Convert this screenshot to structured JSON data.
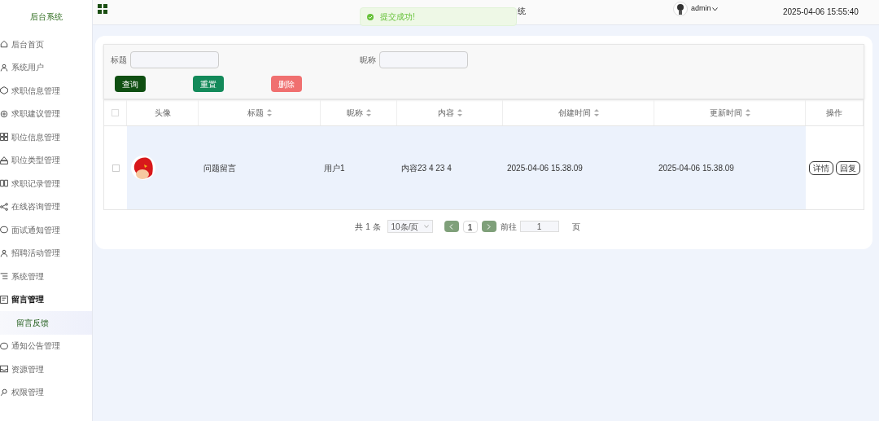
{
  "sidebar": {
    "title": "后台系统",
    "items": [
      {
        "label": "后台首页",
        "selected": false,
        "expanded": false
      },
      {
        "label": "系统用户",
        "selected": false,
        "expanded": false
      },
      {
        "label": "求职信息管理",
        "selected": false,
        "expanded": false
      },
      {
        "label": "求职建议管理",
        "selected": false,
        "expanded": false
      },
      {
        "label": "职位信息管理",
        "selected": false,
        "expanded": false
      },
      {
        "label": "职位类型管理",
        "selected": false,
        "expanded": false
      },
      {
        "label": "求职记录管理",
        "selected": false,
        "expanded": false
      },
      {
        "label": "在线咨询管理",
        "selected": false,
        "expanded": false
      },
      {
        "label": "面试通知管理",
        "selected": false,
        "expanded": false
      },
      {
        "label": "招聘活动管理",
        "selected": false,
        "expanded": false
      },
      {
        "label": "系统管理",
        "selected": false,
        "expanded": false
      },
      {
        "label": "留言管理",
        "selected": false,
        "expanded": true,
        "children": [
          {
            "label": "留言反馈",
            "selected": true
          }
        ]
      },
      {
        "label": "通知公告管理",
        "selected": false,
        "expanded": false
      },
      {
        "label": "资源管理",
        "selected": false,
        "expanded": false
      },
      {
        "label": "权限管理",
        "selected": false,
        "expanded": false
      }
    ]
  },
  "header": {
    "title_fragment": "统",
    "user": "admin",
    "datetime": "2025-04-06 15:55:40"
  },
  "toast": {
    "message": "提交成功!"
  },
  "search": {
    "fields": [
      {
        "label": "标题"
      },
      {
        "label": "昵称"
      }
    ],
    "buttons": [
      {
        "label": "查询",
        "kind": "query"
      },
      {
        "label": "重置",
        "kind": "reset"
      },
      {
        "label": "删除",
        "kind": "delete"
      }
    ]
  },
  "table": {
    "select_all_checked": false,
    "columns": [
      {
        "label": "头像",
        "kind": "plain"
      },
      {
        "label": "标题",
        "kind": "sortable"
      },
      {
        "label": "昵称",
        "kind": "sortable"
      },
      {
        "label": "内容",
        "kind": "sortable"
      },
      {
        "label": "创建时间",
        "kind": "sortable"
      },
      {
        "label": "更新时间",
        "kind": "sortable"
      },
      {
        "label": "操作",
        "kind": "plain"
      }
    ],
    "rows": [
      {
        "checked": false,
        "title": "问题留言",
        "nickname": "用户1",
        "content": "内容23 4 23 4",
        "created": "2025-04-06 15.38.09",
        "updated": "2025-04-06 15.38.09",
        "actions": [
          "详情",
          "回复"
        ]
      }
    ]
  },
  "pagination": {
    "total": "共 1 条",
    "page_size": "10条/页",
    "current": "1",
    "goto_label": "前往",
    "goto_value": "1",
    "page_unit": "页"
  }
}
